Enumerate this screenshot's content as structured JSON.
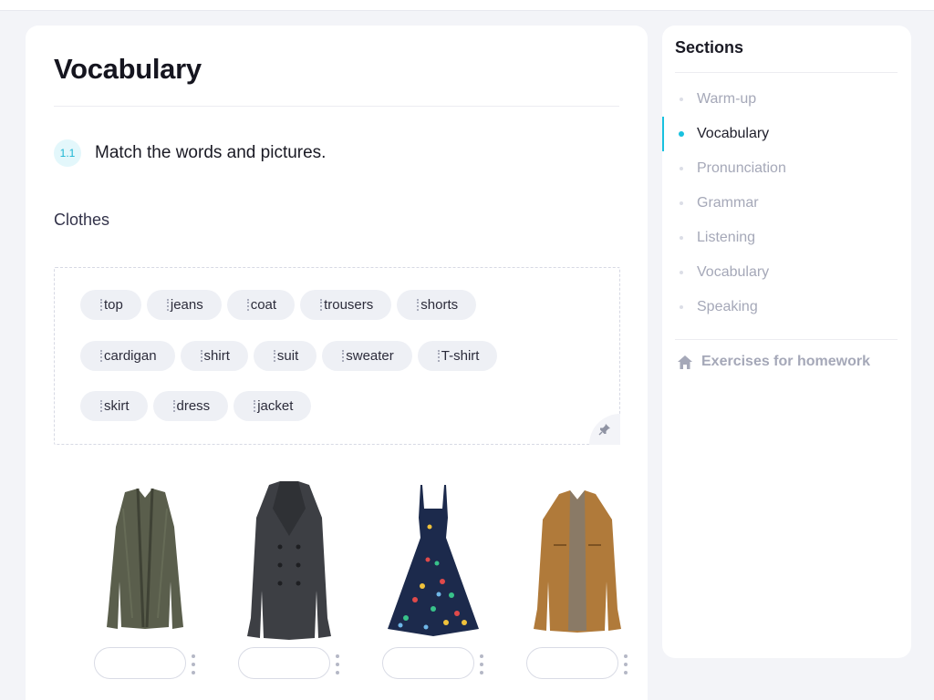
{
  "page": {
    "title": "Vocabulary",
    "exercise": {
      "number": "1.1",
      "instruction": "Match the words and pictures."
    },
    "topic": "Clothes"
  },
  "word_bank": {
    "rows": [
      [
        "top",
        "jeans",
        "coat",
        "trousers",
        "shorts"
      ],
      [
        "cardigan",
        "shirt",
        "suit",
        "sweater",
        "T-shirt"
      ],
      [
        "skirt",
        "dress",
        "jacket"
      ]
    ]
  },
  "pictures": [
    {
      "item": "cardigan-image",
      "color": "#5a5e4c"
    },
    {
      "item": "coat-image",
      "color": "#3d3f44"
    },
    {
      "item": "dress-image",
      "color": "#1c2a4c"
    },
    {
      "item": "jacket-image",
      "color": "#b07a3a"
    }
  ],
  "sidebar": {
    "title": "Sections",
    "items": [
      {
        "label": "Warm-up",
        "active": false
      },
      {
        "label": "Vocabulary",
        "active": true
      },
      {
        "label": "Pronunciation",
        "active": false
      },
      {
        "label": "Grammar",
        "active": false
      },
      {
        "label": "Listening",
        "active": false
      },
      {
        "label": "Vocabulary",
        "active": false
      },
      {
        "label": "Speaking",
        "active": false
      }
    ],
    "homework_label": "Exercises for homework"
  },
  "colors": {
    "accent": "#19c1df",
    "muted": "#a5a8b8"
  }
}
